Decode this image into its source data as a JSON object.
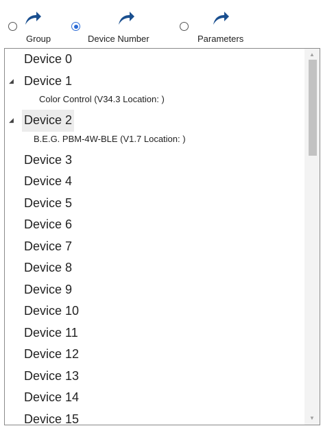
{
  "sort_options": [
    {
      "label": "Group",
      "checked": false
    },
    {
      "label": "Device Number",
      "checked": true
    },
    {
      "label": "Parameters",
      "checked": false
    }
  ],
  "icons": {
    "sort_arrow": "curved-arrow-icon",
    "expand": "expanded-triangle-icon",
    "scroll_up": "scroll-up-arrow-icon",
    "scroll_down": "scroll-down-arrow-icon"
  },
  "colors": {
    "accent": "#2b6bd6",
    "arrow": "#1a4f8f",
    "selection": "#ececec"
  },
  "tree": {
    "expander_glyph": "◢",
    "items": [
      {
        "label": "Device 0"
      },
      {
        "label": "Device 1",
        "expanded": true,
        "child": "Color Control (V34.3 Location: )"
      },
      {
        "label": "Device 2",
        "expanded": true,
        "selected": true,
        "child": "B.E.G. PBM-4W-BLE (V1.7 Location: )"
      },
      {
        "label": "Device 3"
      },
      {
        "label": "Device 4"
      },
      {
        "label": "Device 5"
      },
      {
        "label": "Device 6"
      },
      {
        "label": "Device 7"
      },
      {
        "label": "Device 8"
      },
      {
        "label": "Device 9"
      },
      {
        "label": "Device 10"
      },
      {
        "label": "Device 11"
      },
      {
        "label": "Device 12"
      },
      {
        "label": "Device 13"
      },
      {
        "label": "Device 14"
      },
      {
        "label": "Device 15"
      }
    ]
  },
  "scrollbar": {
    "up_glyph": "▲",
    "down_glyph": "▼"
  }
}
